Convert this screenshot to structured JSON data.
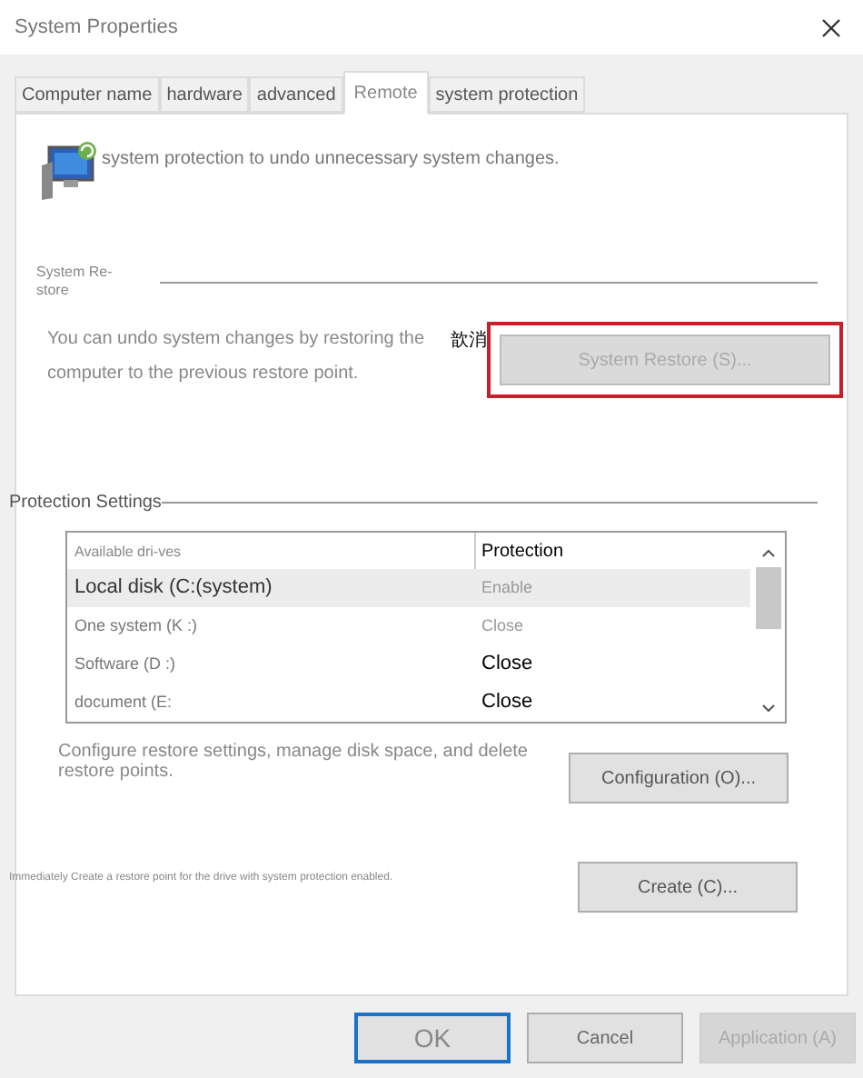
{
  "window": {
    "title": "System Properties"
  },
  "tabs": [
    {
      "label": "Computer name",
      "selected": false
    },
    {
      "label": "hardware",
      "selected": false
    },
    {
      "label": "advanced",
      "selected": false
    },
    {
      "label": "Remote",
      "selected": true
    },
    {
      "label": "system protection",
      "selected": false
    }
  ],
  "intro": "system protection to undo unnecessary system changes.",
  "system_restore": {
    "heading": "System Re-store",
    "description": "You can undo system changes by restoring the computer to the previous restore point.",
    "overlap_text": "歆消",
    "button": {
      "label": "System Restore (S)...",
      "disabled": true,
      "highlighted": true
    }
  },
  "protection_settings": {
    "heading": "Protection Settings",
    "table": {
      "columns": [
        "Available dri-ves",
        "Protection"
      ],
      "rows": [
        {
          "drive": "Local disk (C:(system)",
          "protection": "Enable",
          "selected": true,
          "dimmed": true
        },
        {
          "drive": "One system (K :)",
          "protection": "Close",
          "selected": false,
          "dimmed": true
        },
        {
          "drive": "Software (D :)",
          "protection": "Close",
          "selected": false,
          "dimmed": false
        },
        {
          "drive": "document (E:",
          "protection": "Close",
          "selected": false,
          "dimmed": false
        }
      ]
    },
    "configure_text": "Configure restore settings, manage disk space, and delete restore points.",
    "configure_button": "Configuration (O)...",
    "create_text": "Immediately Create a restore point for the drive with system protection enabled.",
    "create_button": "Create (C)..."
  },
  "buttons": [
    {
      "label": "OK",
      "kind": "default",
      "disabled": false
    },
    {
      "label": "Cancel",
      "kind": "normal",
      "disabled": false
    },
    {
      "label": "Application (A)",
      "kind": "normal",
      "disabled": true
    }
  ]
}
